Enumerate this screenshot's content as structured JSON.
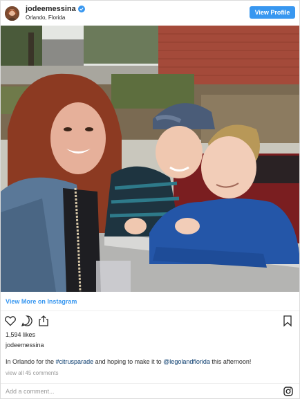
{
  "header": {
    "username": "jodeemessina",
    "location": "Orlando, Florida",
    "view_profile_label": "View Profile",
    "verified_icon": "verified-badge-icon",
    "accent_color": "#3897f0"
  },
  "post": {
    "photo_description_icon": "post-photo",
    "view_more_label": "View More on Instagram",
    "likes": "1,594 likes",
    "caption_user": "jodeemessina",
    "caption_prefix": "In Orlando for the ",
    "caption_hashtag": "#citrusparade",
    "caption_middle": " and hoping to make it to ",
    "caption_mention": "@legolandflorida",
    "caption_suffix": " this afternoon!",
    "view_all_comments": "view all 45 comments"
  },
  "actions": {
    "like_icon": "heart-icon",
    "comment_icon": "comment-icon",
    "share_icon": "share-icon",
    "save_icon": "bookmark-icon"
  },
  "comment_box": {
    "placeholder": "Add a comment...",
    "logo_icon": "instagram-logo-icon"
  }
}
